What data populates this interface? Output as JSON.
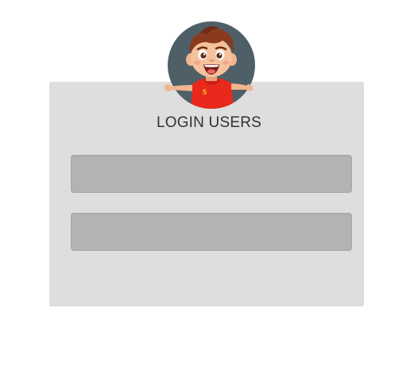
{
  "login": {
    "title": "LOGIN USERS",
    "username_value": "",
    "password_value": ""
  },
  "avatar": {
    "icon": "cartoon-boy-avatar-icon",
    "jersey_number": "5"
  },
  "colors": {
    "page_background": "#ffffff",
    "card_background": "#dedede",
    "field_background": "#b3b3b3",
    "avatar_circle": "#4f5f68",
    "jersey_red": "#e8291c",
    "title_text": "#333333"
  }
}
